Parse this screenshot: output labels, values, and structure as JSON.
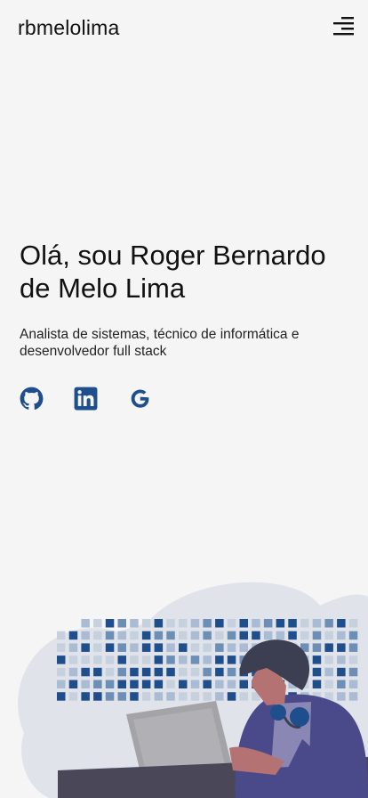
{
  "header": {
    "brand": "rbmelolima",
    "menu_icon": "menu-icon"
  },
  "hero": {
    "title": "Olá, sou Roger Bernardo de Melo Lima",
    "subtitle": "Analista de sistemas, técnico de informática e desenvolvedor full stack"
  },
  "social": [
    {
      "name": "github",
      "icon": "github-icon"
    },
    {
      "name": "linkedin",
      "icon": "linkedin-icon"
    },
    {
      "name": "google",
      "icon": "google-icon"
    }
  ],
  "colors": {
    "background": "#f5f5f5",
    "accent": "#1e4e8c",
    "cloud": "#e0e3ea",
    "illustration_purple": "#4a4a8a"
  }
}
